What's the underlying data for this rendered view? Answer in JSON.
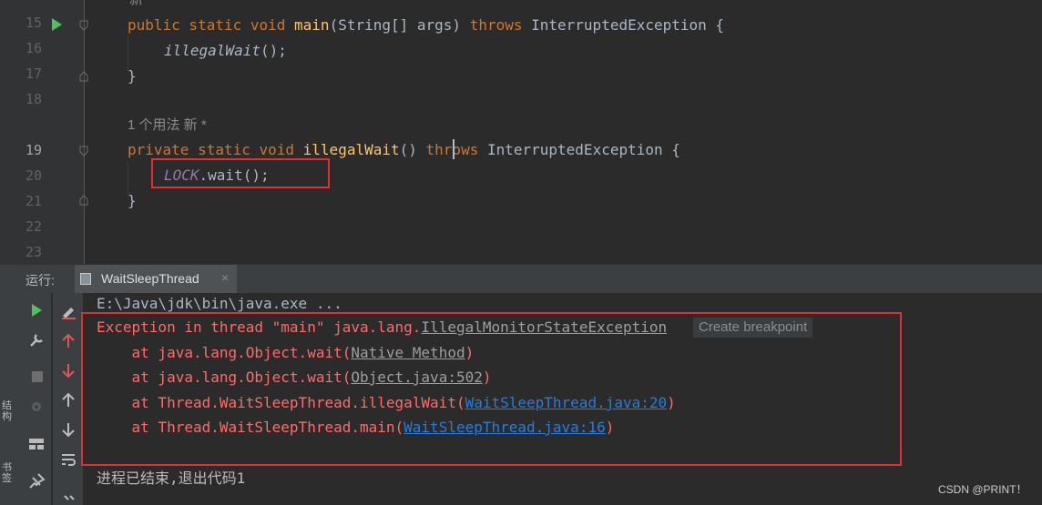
{
  "editor": {
    "top_partial": "新",
    "line_numbers": [
      "15",
      "16",
      "17",
      "18",
      "19",
      "20",
      "21",
      "22",
      "23"
    ],
    "usage_hint": "1 个用法   新 *",
    "lines": {
      "l15": {
        "kw1": "public static void ",
        "fn": "main",
        "rest": "(String[] args) ",
        "kw2": "throws ",
        "type": "InterruptedException ",
        "brace": "{"
      },
      "l16": {
        "call": "illegalWait",
        "rest": "();"
      },
      "l17": {
        "brace": "}"
      },
      "l19": {
        "kw1": "private static void ",
        "fn": "illegalWait",
        "rest": "() ",
        "kw2": "throws ",
        "type": "InterruptedException ",
        "brace": "{"
      },
      "l20": {
        "const": "LOCK",
        "rest": ".wait();"
      },
      "l21": {
        "brace": "}"
      }
    }
  },
  "run_panel": {
    "label": "运行:",
    "tab_label": "WaitSleepThread",
    "close_glyph": "×"
  },
  "console": {
    "command": "E:\\Java\\jdk\\bin\\java.exe ...",
    "exception_prefix": "Exception in thread \"main\" java.lang.",
    "exception_class": "IllegalMonitorStateException",
    "create_breakpoint": "Create breakpoint",
    "trace": [
      {
        "prefix": "    at java.lang.Object.wait(",
        "link": "Native Method",
        "suffix": ")"
      },
      {
        "prefix": "    at java.lang.Object.wait(",
        "link": "Object.java:502",
        "suffix": ")"
      },
      {
        "prefix": "    at Thread.WaitSleepThread.illegalWait(",
        "link": "WaitSleepThread.java:20",
        "suffix": ")"
      },
      {
        "prefix": "    at Thread.WaitSleepThread.main(",
        "link": "WaitSleepThread.java:16",
        "suffix": ")"
      }
    ],
    "exit_message": "进程已结束,退出代码1"
  },
  "side_labels": {
    "structure": "结构",
    "bookmarks": "书签"
  },
  "watermark": "CSDN @PRINT！",
  "colors": {
    "keyword": "#cc7832",
    "function": "#ffc66d",
    "error": "#ff6b68",
    "link": "#287bde",
    "highlight_box": "#e0302f"
  }
}
